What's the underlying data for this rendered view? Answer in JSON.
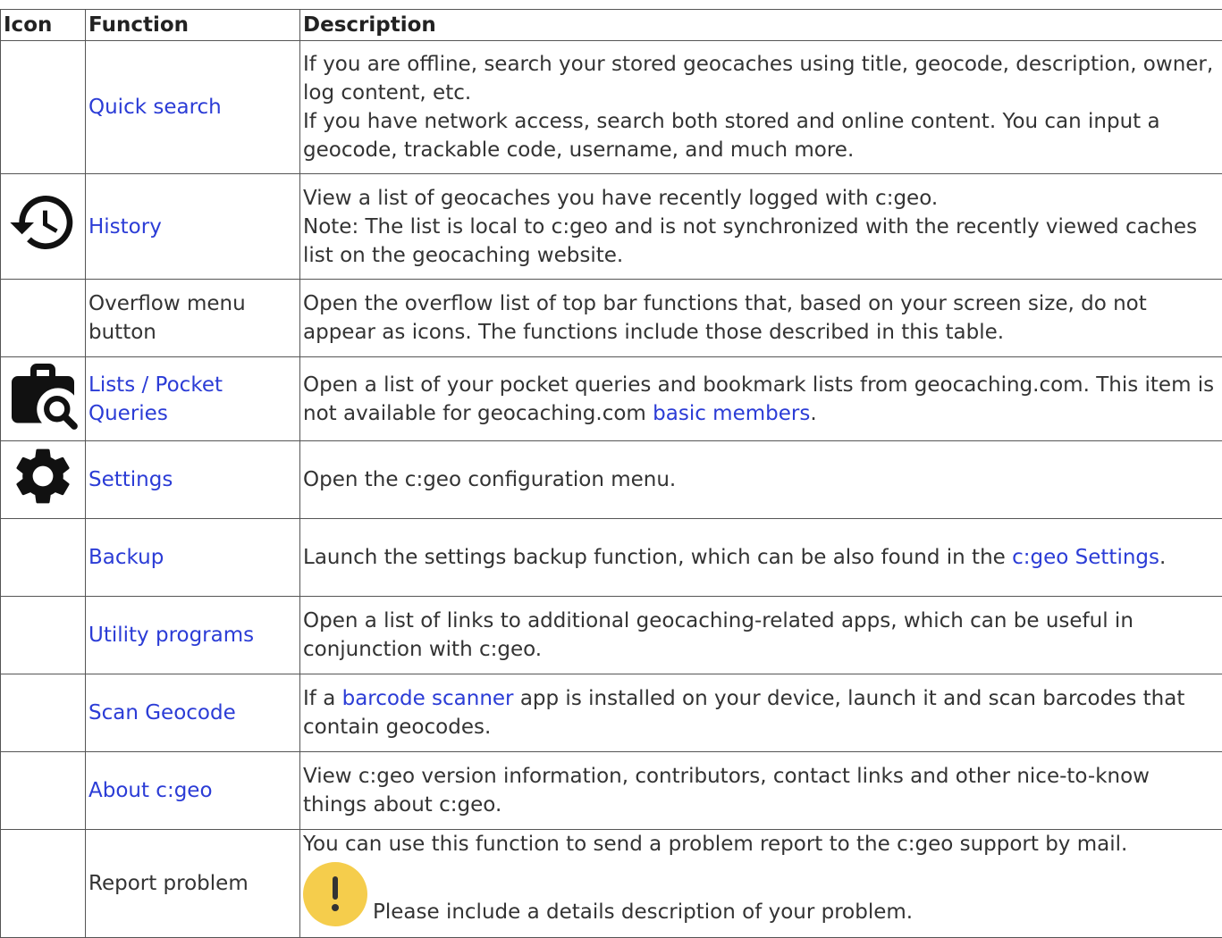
{
  "table": {
    "headers": [
      "Icon",
      "Function",
      "Description"
    ],
    "rows": [
      {
        "icon": "",
        "function": "Quick search",
        "function_link": true,
        "description": [
          "If you are offline, search your stored geocaches using title, geocode, description, owner, log content, etc.",
          "If you have network access, search both stored and online content. You can input a geocode, trackable code, username, and much more."
        ]
      },
      {
        "icon": "history-icon",
        "function": "History",
        "function_link": true,
        "description": [
          "View a list of geocaches you have recently logged with c:geo.",
          "Note: The list is local to c:geo and is not synchronized with the recently viewed caches list on the geocaching website."
        ]
      },
      {
        "icon": "",
        "function": "Overflow menu button",
        "function_link": false,
        "description": [
          "Open the overflow list of top bar functions that, based on your screen size, do not appear as icons. The functions include those described in this table."
        ]
      },
      {
        "icon": "briefcase-search-icon",
        "function": "Lists / Pocket Queries",
        "function_link": true,
        "description_before": "Open a list of your pocket queries and bookmark lists from geocaching.com. This item is not available for geocaching.com ",
        "description_link": "basic members",
        "description_after": "."
      },
      {
        "icon": "gear-icon",
        "function": "Settings",
        "function_link": true,
        "description": [
          "Open the c:geo configuration menu."
        ]
      },
      {
        "icon": "",
        "function": "Backup",
        "function_link": true,
        "description_before": "Launch the settings backup function, which can be also found in the ",
        "description_link": "c:geo Settings",
        "description_after": "."
      },
      {
        "icon": "",
        "function": "Utility programs",
        "function_link": true,
        "description": [
          "Open a list of links to additional geocaching-related apps, which can be useful in conjunction with c:geo."
        ]
      },
      {
        "icon": "",
        "function": "Scan Geocode",
        "function_link": true,
        "description_before": "If a ",
        "description_link": "barcode scanner",
        "description_after": " app is installed on your device, launch it and scan barcodes that contain geocodes."
      },
      {
        "icon": "",
        "function": "About c:geo",
        "function_link": true,
        "description": [
          "View c:geo version information, contributors, contact links and other nice-to-know things about c:geo."
        ]
      },
      {
        "icon": "",
        "function": "Report problem",
        "function_link": false,
        "description": [
          "You can use this function to send a problem report to the c:geo support by mail."
        ],
        "note": "Please include a details description of your problem.",
        "note_icon": "exclamation-icon"
      }
    ]
  },
  "colors": {
    "link": "#2b3cd6",
    "text": "#333333",
    "border": "#555555",
    "note_icon_bg": "#f5cd4c"
  }
}
